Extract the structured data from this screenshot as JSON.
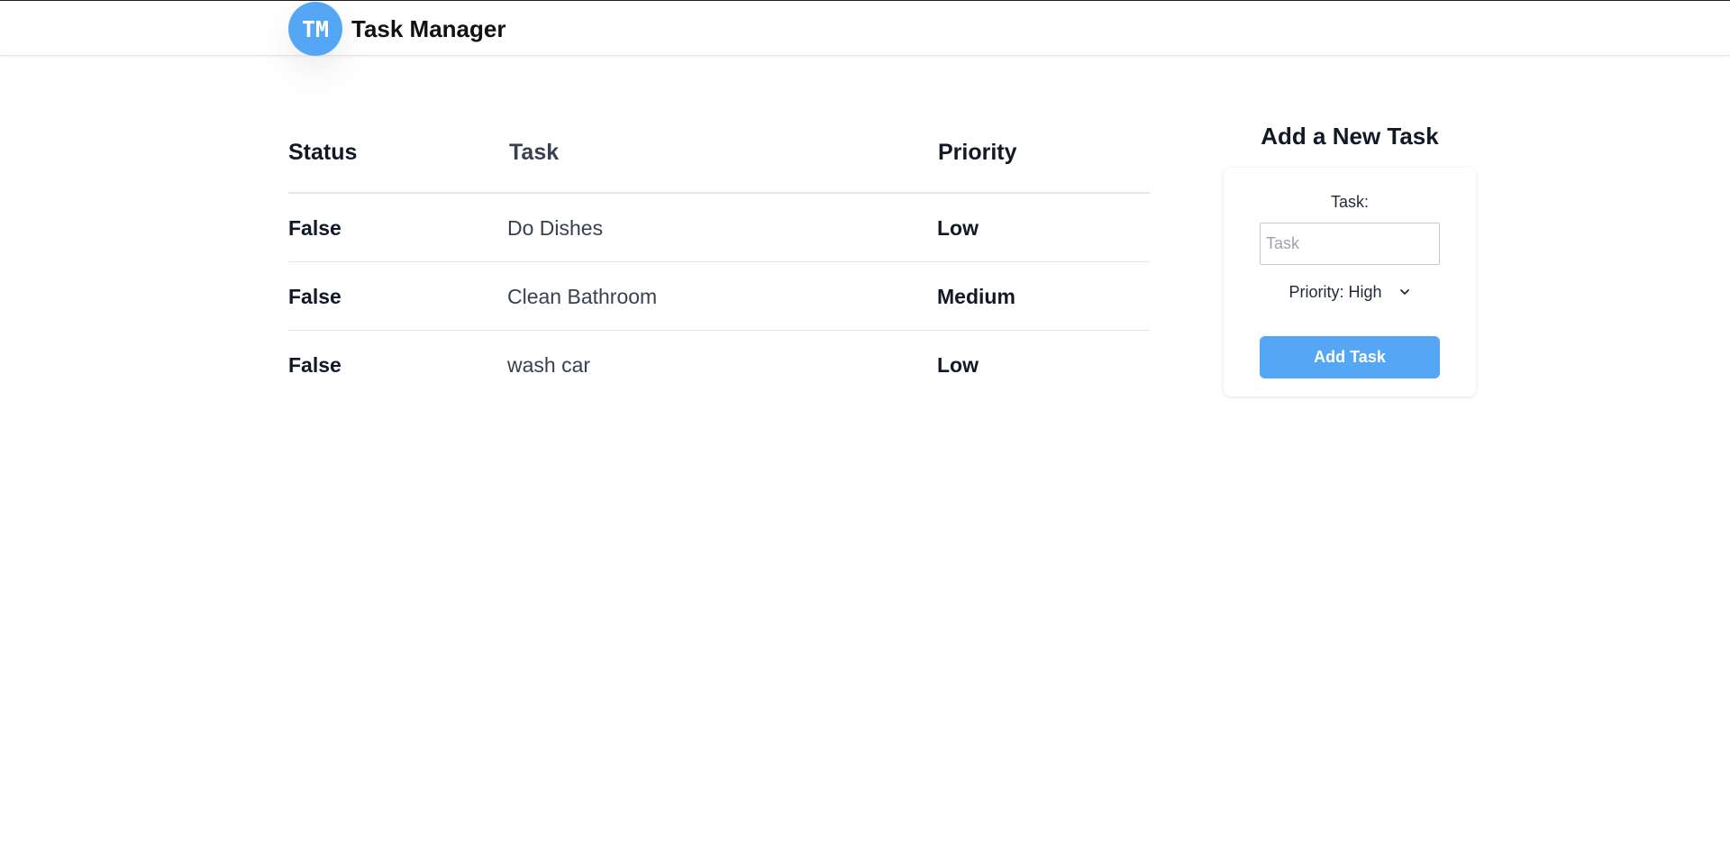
{
  "header": {
    "logo_text": "TM",
    "title": "Task Manager",
    "brand_color": "#55a7f5"
  },
  "table": {
    "columns": [
      "Status",
      "Task",
      "Priority"
    ],
    "rows": [
      {
        "status": "False",
        "task": "Do Dishes",
        "priority": "Low"
      },
      {
        "status": "False",
        "task": "Clean Bathroom",
        "priority": "Medium"
      },
      {
        "status": "False",
        "task": "wash car",
        "priority": "Low"
      }
    ]
  },
  "form": {
    "heading": "Add a New Task",
    "task_label": "Task:",
    "task_placeholder": "Task",
    "task_value": "",
    "priority_label": "Priority: High",
    "priority_icon": "chevron-down-icon",
    "submit_label": "Add Task"
  }
}
